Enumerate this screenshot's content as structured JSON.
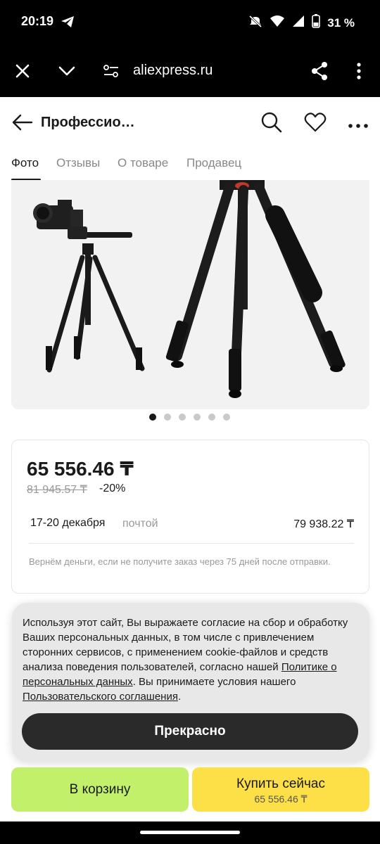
{
  "status_bar": {
    "time": "20:19",
    "battery": "31 %",
    "icons": [
      "telegram-icon",
      "mute-icon",
      "wifi-icon",
      "signal-icon",
      "battery-icon"
    ]
  },
  "browser": {
    "url": "aliexpress.ru",
    "icons": [
      "close-icon",
      "chevron-down-icon",
      "site-settings-icon",
      "share-icon",
      "more-vertical-icon"
    ]
  },
  "header": {
    "title": "Профессио…",
    "icons": [
      "back-arrow-icon",
      "search-icon",
      "heart-icon",
      "more-horizontal-icon"
    ]
  },
  "tabs": [
    {
      "label": "Фото",
      "active": true
    },
    {
      "label": "Отзывы",
      "active": false
    },
    {
      "label": "О товаре",
      "active": false
    },
    {
      "label": "Продавец",
      "active": false
    }
  ],
  "gallery": {
    "image_count": 6,
    "active_index": 0
  },
  "price": {
    "current": "65 556.46 ₸",
    "old": "81 945.57 ₸",
    "discount": "-20%"
  },
  "delivery": {
    "date": "17-20 декабря",
    "method": "почтой",
    "price": "79 938.22 ₸",
    "refund_note": "Вернём деньги, если не получите заказ через 75 дней после отправки."
  },
  "cookie": {
    "text_1": "Используя этот сайт, Вы выражаете согласие на сбор и обработку Ваших персональных данных, в том числе с привлечением сторонних сервисов, с применением cookie-файлов и средств анализа поведения пользователей, согласно нашей ",
    "link_privacy": "Политике о персональных данных",
    "text_2": ". Вы принимаете условия нашего ",
    "link_terms": "Пользовательского соглашения",
    "text_3": ".",
    "button": "Прекрасно"
  },
  "actions": {
    "cart": "В корзину",
    "buy": "Купить сейчас",
    "buy_price": "65 556.46 ₸"
  },
  "colors": {
    "cart_button": "#c2f06a",
    "buy_button": "#fde047",
    "cookie_button": "#2a2a2a"
  }
}
